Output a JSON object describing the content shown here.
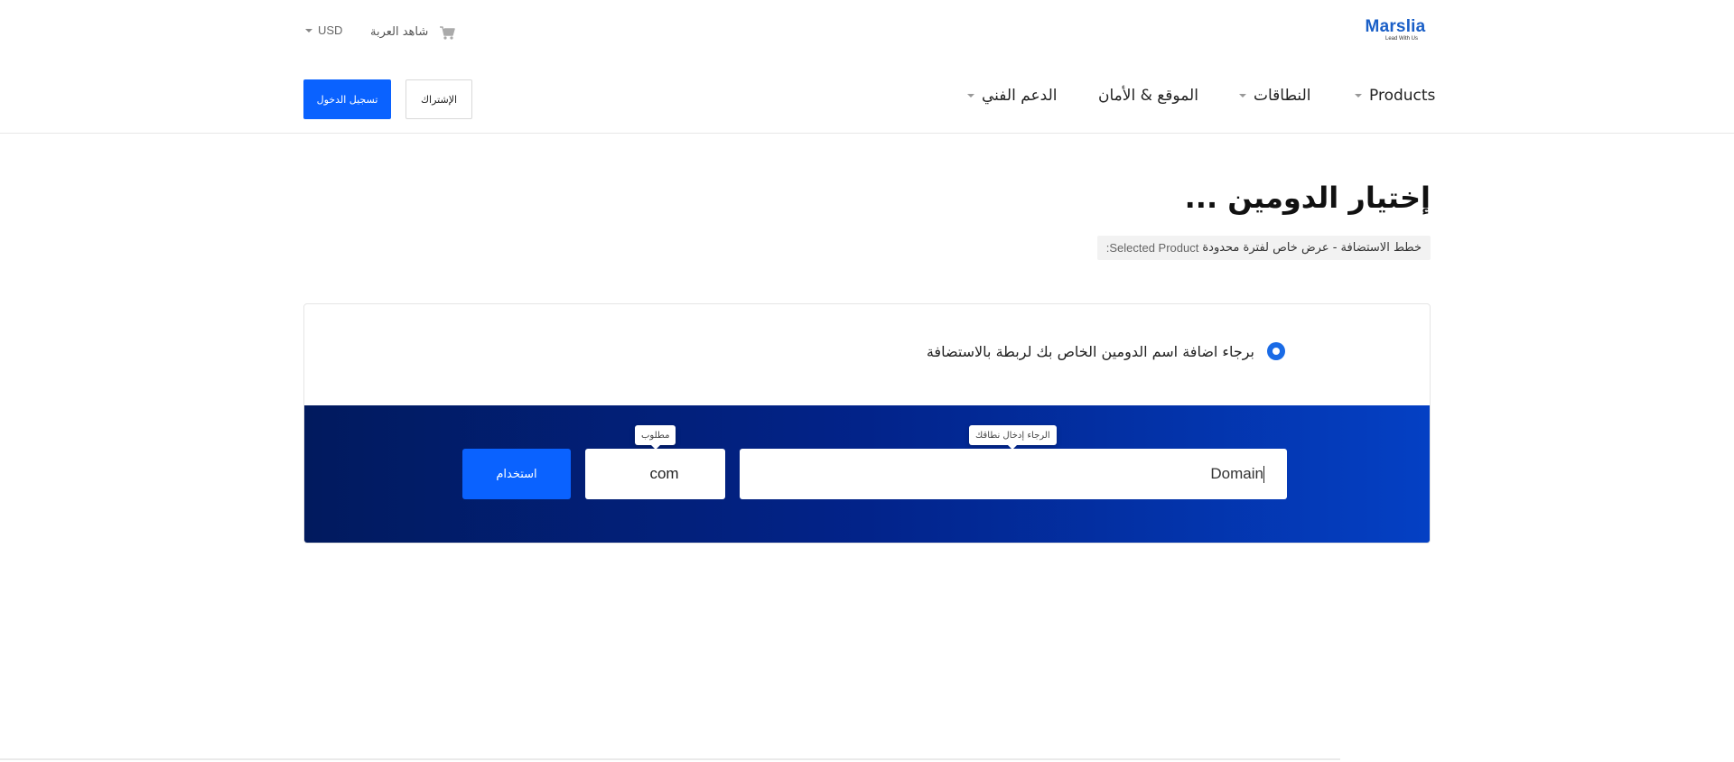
{
  "brand": {
    "logo_text": "Marslia",
    "logo_tagline": "Lead With Us",
    "logo_color": "#1a5fc7"
  },
  "topbar": {
    "cart_label": "شاهد العربة",
    "cart_icon": "cart-icon",
    "currency_label": "USD"
  },
  "nav": {
    "items": [
      {
        "label": "Products",
        "has_dropdown": true
      },
      {
        "label": "النطاقات",
        "has_dropdown": true
      },
      {
        "label": "الموقع & الأمان",
        "has_dropdown": false
      },
      {
        "label": "الدعم الفني",
        "has_dropdown": true
      }
    ],
    "login_label": "تسجيل الدخول",
    "signup_label": "الإشتراك"
  },
  "page": {
    "title": "إختيار الدومين ...",
    "selected_product_label": "Selected Product:",
    "selected_product_value": "خطط الاستضافة - عرض خاص لفترة محدودة"
  },
  "domain_form": {
    "option_label": "برجاء اضافة اسم الدومين الخاص بك لربطة بالاستضافة",
    "option_selected": true,
    "domain_value": "Domain",
    "domain_tooltip": "الرجاء إدخال نطاقك",
    "tld_value": "com",
    "tld_tooltip": "مطلوب",
    "submit_label": "استخدام"
  },
  "colors": {
    "accent": "#0a62ff",
    "panel_dark": "#011a5e",
    "panel_light": "#0440c4"
  }
}
